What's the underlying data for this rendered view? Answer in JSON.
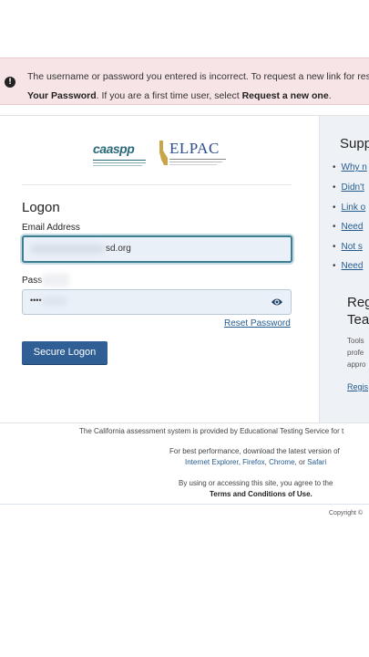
{
  "alert": {
    "line1": "The username or password you entered is incorrect. To request a new link for rese",
    "line2_pre": "Your Password",
    "line2_mid": ". If you are a first time user, select ",
    "line2_link": "Request a new one",
    "line2_end": "."
  },
  "logos": {
    "caaspp": "caaspp",
    "elpac": "ELPAC"
  },
  "logon": {
    "title": "Logon",
    "email_label": "Email Address",
    "email_value": "sd.org",
    "password_label": "Pass",
    "password_value": "••••",
    "reset_link": "Reset Password",
    "button": "Secure Logon"
  },
  "support": {
    "title": "Supp",
    "items": [
      "Why n",
      "Didn't",
      "Link o",
      "Need",
      "Not s",
      "Need"
    ]
  },
  "register": {
    "title_line1": "Reg",
    "title_line2": "Tea",
    "text_line1": "Tools",
    "text_line2": "profe",
    "text_line3": "appro",
    "link": "Regis"
  },
  "footer": {
    "line1": "The California assessment system is provided by Educational Testing Service for t",
    "line2": "For best performance, download the latest version of",
    "browser1": "Internet Explorer",
    "browser2": "Firefox",
    "browser3": "Chrome",
    "browser_or": ", or ",
    "browser4": "Safari",
    "line4": "By using or accessing this site, you agree to the",
    "line5": "Terms and Conditions of Use.",
    "copyright": "Copyright ©"
  },
  "colors": {
    "alert_bg": "#f7e4e6",
    "button_bg": "#2f5f94",
    "link": "#245b8f",
    "sidebar_bg": "#eef2f7"
  }
}
